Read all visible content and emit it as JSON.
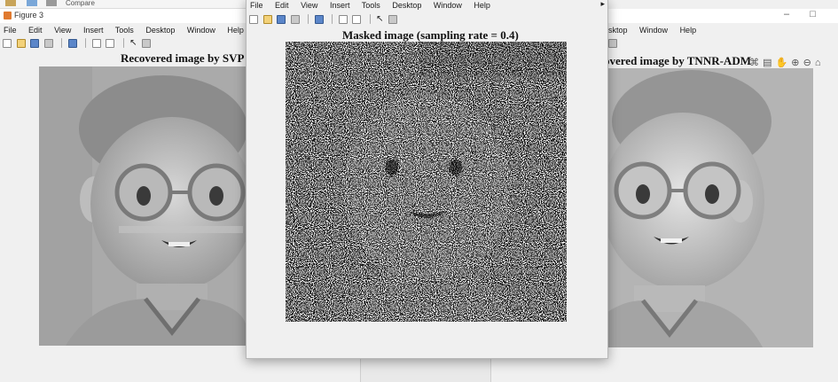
{
  "left_window": {
    "title": "Figure 3",
    "menu": [
      "File",
      "Edit",
      "View",
      "Insert",
      "Tools",
      "Desktop",
      "Window",
      "Help"
    ],
    "plot_title": "Recovered image by SVP",
    "taskbar_text": "Compare"
  },
  "middle_window": {
    "menu": [
      "File",
      "Edit",
      "View",
      "Insert",
      "Tools",
      "Desktop",
      "Window",
      "Help"
    ],
    "plot_title": "Masked image (sampling rate = 0.4)"
  },
  "right_window": {
    "menu": [
      "sktop",
      "Window",
      "Help"
    ],
    "plot_title": "overed image by TNNR-ADM"
  },
  "icons": [
    "new-file-icon",
    "open-folder-icon",
    "save-icon",
    "print-icon",
    "link-icon",
    "property-editor-icon",
    "pointer-icon",
    "plot-browser-icon",
    "minimize-icon",
    "maximize-icon",
    "zoom-in-icon",
    "zoom-out-icon",
    "pan-icon",
    "home-icon",
    "data-cursor-icon"
  ]
}
